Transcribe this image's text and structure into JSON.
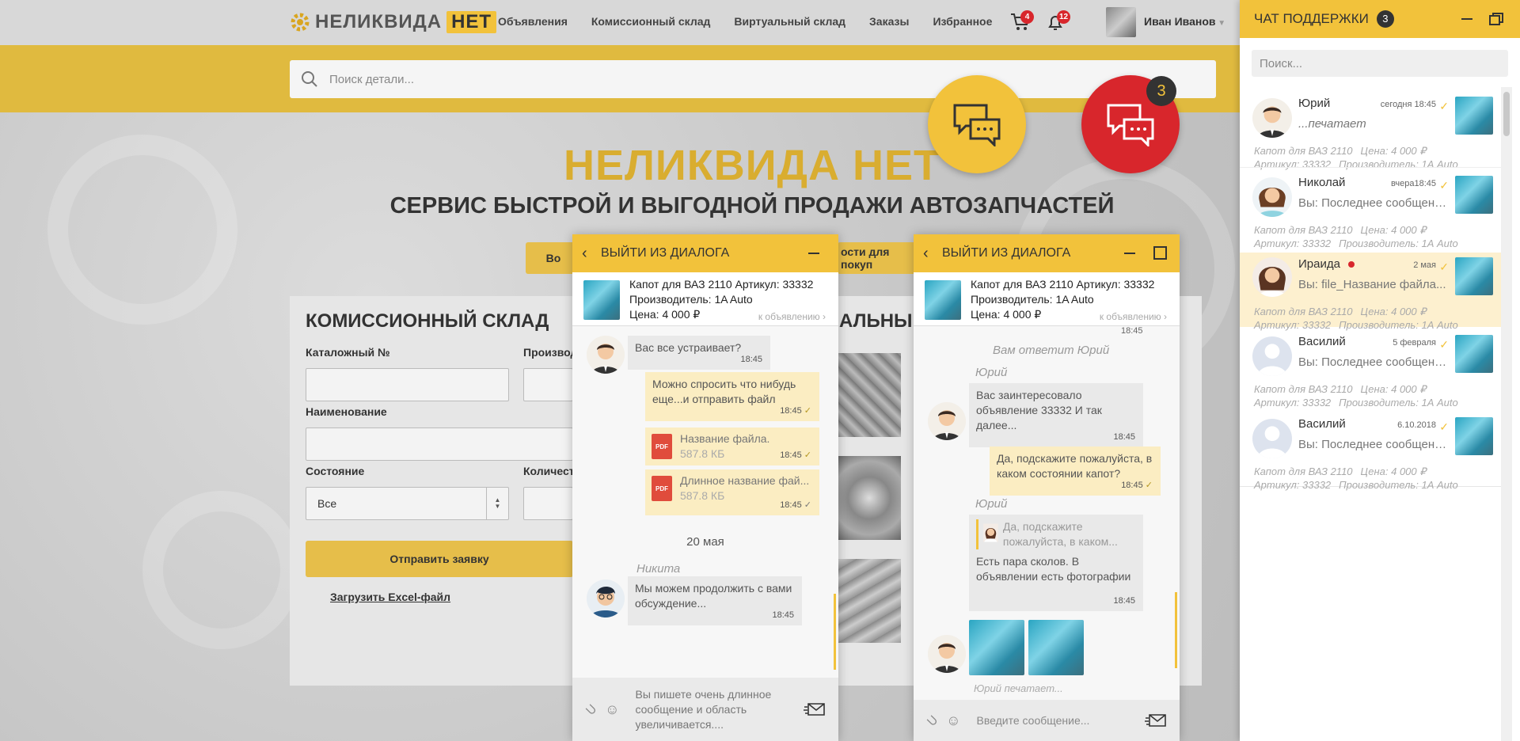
{
  "header": {
    "logo_main": "НЕЛИКВИДА",
    "logo_accent": "НЕТ",
    "nav": [
      "Объявления",
      "Комиссионный склад",
      "Виртуальный склад",
      "Заказы",
      "Избранное"
    ],
    "cart_count": "4",
    "notif_count": "12",
    "user_name": "Иван Иванов"
  },
  "search": {
    "placeholder": "Поиск детали..."
  },
  "hero": {
    "title": "НЕЛИКВИДА НЕТ",
    "subtitle": "СЕРВИС БЫСТРОЙ И ВЫГОДНОЙ ПРОДАЖИ АВТОЗАПЧАСТЕЙ",
    "btn_left": "Во",
    "btn_right": "ости для покуп"
  },
  "form": {
    "title": "КОМИССИОННЫЙ СКЛАД",
    "catalog_label": "Каталожный №",
    "producer_label": "Производ",
    "name_label": "Наименование",
    "state_label": "Состояние",
    "state_value": "Все",
    "qty_label": "Количест",
    "submit": "Отправить заявку",
    "excel": "Загрузить Excel-файл",
    "right_title": "АЛЬНЫЙ"
  },
  "fab": {
    "badge": "3"
  },
  "chat1": {
    "back": "ВЫЙТИ ИЗ ДИАЛОГА",
    "product_line1": "Капот для ВАЗ 2110  Артикул: 33332",
    "product_line2": "Производитель: 1A Auto",
    "product_line3": "Цена: 4 000 ₽",
    "to_ad": "к объявлению",
    "m1": "Вас все устраивает?",
    "m1_time": "18:45",
    "m2": "Можно спросить что нибудь еще...и отправить файл",
    "m2_time": "18:45",
    "f1_name": "Название файла.",
    "f1_size": "587.8 КБ",
    "f1_time": "18:45",
    "f2_name": "Длинное название фай...",
    "f2_size": "587.8 КБ",
    "f2_time": "18:45",
    "pdf": "PDF",
    "date": "20 мая",
    "sender": "Никита",
    "m3": "Мы можем продолжить с вами обсуждение...",
    "m3_time": "18:45",
    "compose_text": "Вы пишете очень длинное сообщение и область увеличивается...."
  },
  "chat2": {
    "back": "ВЫЙТИ ИЗ ДИАЛОГА",
    "product_line1": "Капот для ВАЗ 2110  Артикул: 33332",
    "product_line2": "Производитель: 1A Auto",
    "product_line3": "Цена: 4 000 ₽",
    "to_ad": "к объявлению",
    "top_time": "18:45",
    "system": "Вам ответит Юрий",
    "sender1": "Юрий",
    "m1": "Вас заинтересовало объявление 33332 И так далее...",
    "m1_time": "18:45",
    "m2": "Да, подскажите пожалуйста, в каком состоянии капот?",
    "m2_time": "18:45",
    "sender2": "Юрий",
    "quote": "Да, подскажите пожалуйста, в каком...",
    "m3": "Есть пара сколов. В объявлении есть фотографии",
    "m3_time": "18:45",
    "typing": "Юрий печатает...",
    "compose_placeholder": "Введите сообщение..."
  },
  "support": {
    "title": "ЧАТ ПОДДЕРЖКИ",
    "count": "3",
    "search_placeholder": "Поиск...",
    "items": [
      {
        "name": "Юрий",
        "time": "сегодня 18:45",
        "preview": "...печатает",
        "spec1": "Капот для ВАЗ 2110",
        "spec2": "Цена: 4 000 ₽",
        "spec3": "Артикул: 33332",
        "spec4": "Производитель: 1А Auto"
      },
      {
        "name": "Николай",
        "time": "вчера18:45",
        "preview": "Вы: Последнее сообщение...",
        "spec1": "Капот для ВАЗ 2110",
        "spec2": "Цена: 4 000 ₽",
        "spec3": "Артикул: 33332",
        "spec4": "Производитель: 1А Auto"
      },
      {
        "name": "Ираида",
        "time": "2 мая",
        "preview": "Вы: file_Название файла...",
        "spec1": "Капот для ВАЗ 2110",
        "spec2": "Цена: 4 000 ₽",
        "spec3": "Артикул: 33332",
        "spec4": "Производитель: 1А Auto"
      },
      {
        "name": "Василий",
        "time": "5 февраля",
        "preview": "Вы: Последнее сообщение...",
        "spec1": "Капот для ВАЗ 2110",
        "spec2": "Цена: 4 000 ₽",
        "spec3": "Артикул: 33332",
        "spec4": "Производитель: 1А Auto"
      },
      {
        "name": "Василий",
        "time": "6.10.2018",
        "preview": "Вы: Последнее сообщение...",
        "spec1": "Капот для ВАЗ 2110",
        "spec2": "Цена: 4 000 ₽",
        "spec3": "Артикул: 33332",
        "spec4": "Производитель: 1А Auto"
      }
    ]
  },
  "colors": {
    "accent": "#f2c23b",
    "red": "#d8262c",
    "selected_row": "#fdf0cf"
  },
  "icons": [
    "gear-logo-icon",
    "cart-icon",
    "bell-icon",
    "search-icon",
    "chat-bubbles-icon",
    "back-chevron-icon",
    "minimize-icon",
    "maximize-icon",
    "attach-icon",
    "emoji-icon",
    "send-icon",
    "check-icon",
    "pdf-icon"
  ]
}
